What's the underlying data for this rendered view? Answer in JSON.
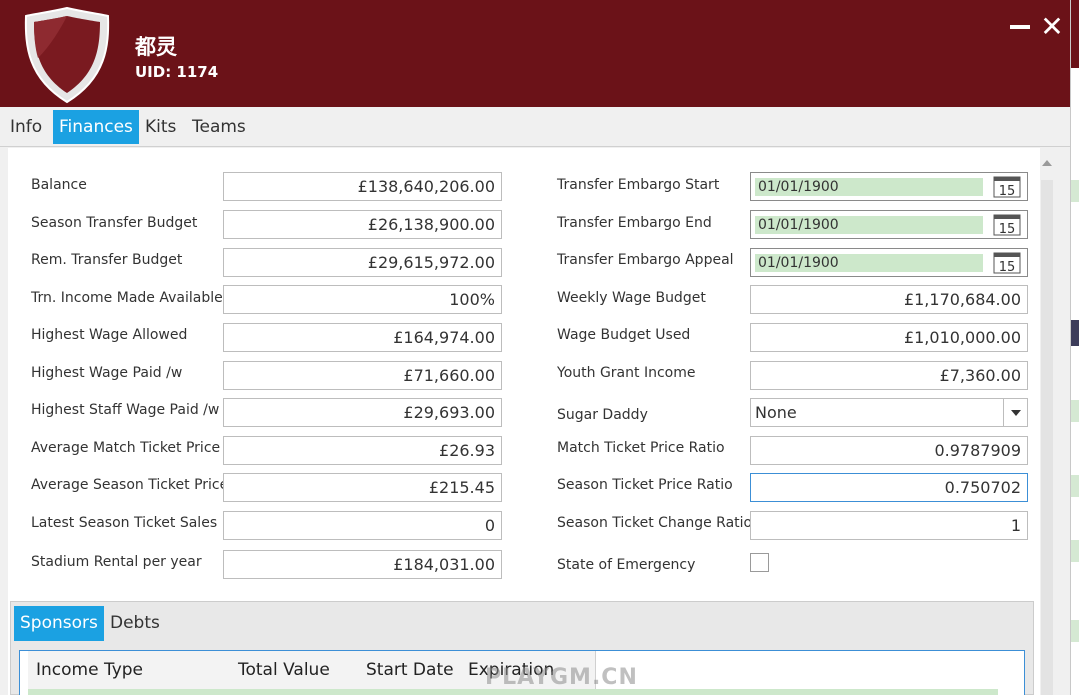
{
  "header": {
    "club_name": "都灵",
    "uid": "UID: 1174",
    "accent": "#6b1218"
  },
  "tabs": [
    "Info",
    "Finances",
    "Kits",
    "Teams"
  ],
  "active_tab": "Finances",
  "left_fields": [
    {
      "label": "Balance",
      "value": "£138,640,206.00"
    },
    {
      "label": "Season Transfer Budget",
      "value": "£26,138,900.00"
    },
    {
      "label": "Rem. Transfer Budget",
      "value": "£29,615,972.00"
    },
    {
      "label": "Trn. Income Made Available",
      "value": "100%"
    },
    {
      "label": "Highest Wage Allowed",
      "value": "£164,974.00"
    },
    {
      "label": "Highest Wage Paid /w",
      "value": "£71,660.00"
    },
    {
      "label": "Highest Staff Wage Paid /w",
      "value": "£29,693.00"
    },
    {
      "label": "Average Match Ticket Price",
      "value": "£26.93"
    },
    {
      "label": "Average Season Ticket Price",
      "value": "£215.45"
    },
    {
      "label": "Latest Season Ticket Sales",
      "value": "0"
    },
    {
      "label": "Stadium Rental per year",
      "value": "£184,031.00"
    }
  ],
  "right_fields": {
    "embargo_start": {
      "label": "Transfer Embargo Start",
      "value": "01/01/1900"
    },
    "embargo_end": {
      "label": "Transfer Embargo End",
      "value": "01/01/1900"
    },
    "embargo_appeal": {
      "label": "Transfer Embargo Appeal",
      "value": "01/01/1900"
    },
    "weekly_wage_budget": {
      "label": "Weekly Wage Budget",
      "value": "£1,170,684.00"
    },
    "wage_budget_used": {
      "label": "Wage Budget Used",
      "value": "£1,010,000.00"
    },
    "youth_grant_income": {
      "label": "Youth Grant Income",
      "value": "£7,360.00"
    },
    "sugar_daddy": {
      "label": "Sugar Daddy",
      "value": "None"
    },
    "match_ticket_ratio": {
      "label": "Match Ticket Price Ratio",
      "value": "0.9787909"
    },
    "season_ticket_ratio": {
      "label": "Season Ticket Price Ratio",
      "value": "0.750702"
    },
    "season_ticket_change": {
      "label": "Season Ticket Change Ratio",
      "value": "1"
    },
    "state_of_emergency": {
      "label": "State of Emergency",
      "checked": false
    }
  },
  "calendar_day": "15",
  "sub_tabs": [
    "Sponsors",
    "Debts"
  ],
  "grid_columns": [
    "Income Type",
    "Total Value",
    "Start Date",
    "Expiration Date"
  ],
  "watermark": "PLAYGM.CN"
}
